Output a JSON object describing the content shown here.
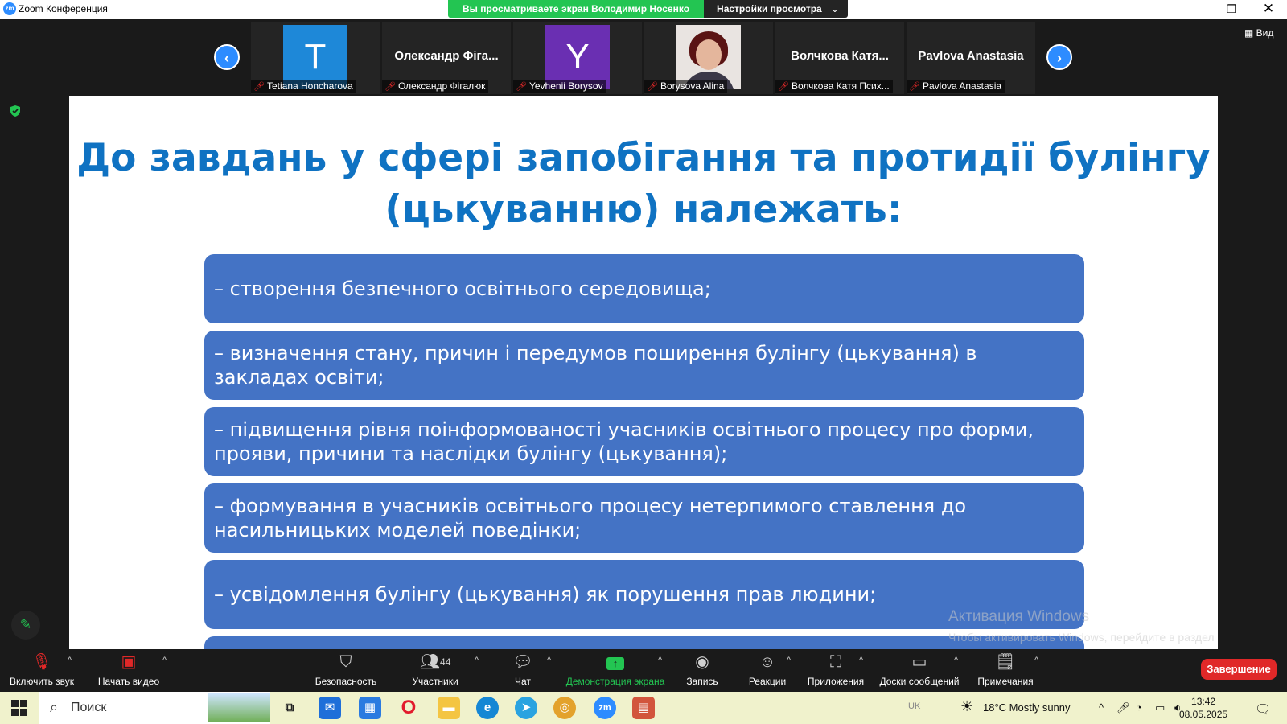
{
  "window": {
    "app_title": "Zoom Конференция",
    "logo_text": "zm",
    "share_banner": "Вы просматриваете экран Володимир Носенко",
    "view_settings": "Настройки просмотра",
    "view_button": "Вид"
  },
  "gallery": {
    "tiles": [
      {
        "avatar_letter": "T",
        "avatar_color": "#1e88d8",
        "label": "Tetiana Honcharova"
      },
      {
        "display_name": "Олександр Фіга...",
        "label": "Олександр Фігалюк"
      },
      {
        "avatar_letter": "Y",
        "avatar_color": "#6a2fb2",
        "label": "Yevhenii Borysov"
      },
      {
        "photo": "participant-photo",
        "label": "Borysova Alina"
      },
      {
        "display_name": "Волчкова Катя...",
        "label": "Волчкова Катя Псих..."
      },
      {
        "display_name": "Pavlova Anastasia",
        "label": "Pavlova Anastasia"
      }
    ]
  },
  "slide": {
    "title_line1": "До завдань у сфері запобігання та протидії булінгу",
    "title_line2": "(цькуванню) належать:",
    "items": [
      "– створення безпечного освітнього середовища;",
      "– визначення стану, причин і передумов поширення булінгу (цькування) в закладах освіти;",
      "– підвищення рівня поінформованості учасників освітнього процесу про форми, прояви, причини та наслідки булінгу (цькування);",
      "– формування в учасників освітнього процесу нетерпимого ставлення до насильницьких моделей поведінки;",
      "– усвідомлення булінгу (цькування) як порушення прав людини;"
    ]
  },
  "watermark": {
    "title": "Активация Windows",
    "subtitle": "Чтобы активировать Windows, перейдите в раздел \"Параметры\"."
  },
  "toolbar": {
    "audio": "Включить звук",
    "video": "Начать видео",
    "security": "Безопасность",
    "participants": "Участники",
    "participants_count": "44",
    "chat": "Чат",
    "share": "Демонстрация экрана",
    "record": "Запись",
    "reactions": "Реакции",
    "apps": "Приложения",
    "whiteboards": "Доски сообщений",
    "notes": "Примечания",
    "end": "Завершение"
  },
  "taskbar": {
    "search_placeholder": "Поиск",
    "weather": "18°C  Mostly sunny",
    "language": "UK",
    "time": "13:42",
    "date": "08.05.2025"
  },
  "colors": {
    "accent_green": "#23c552",
    "zoom_blue": "#2d8cff",
    "slide_title": "#0f72c2",
    "slide_box": "#4473c5",
    "end_red": "#e02828"
  }
}
